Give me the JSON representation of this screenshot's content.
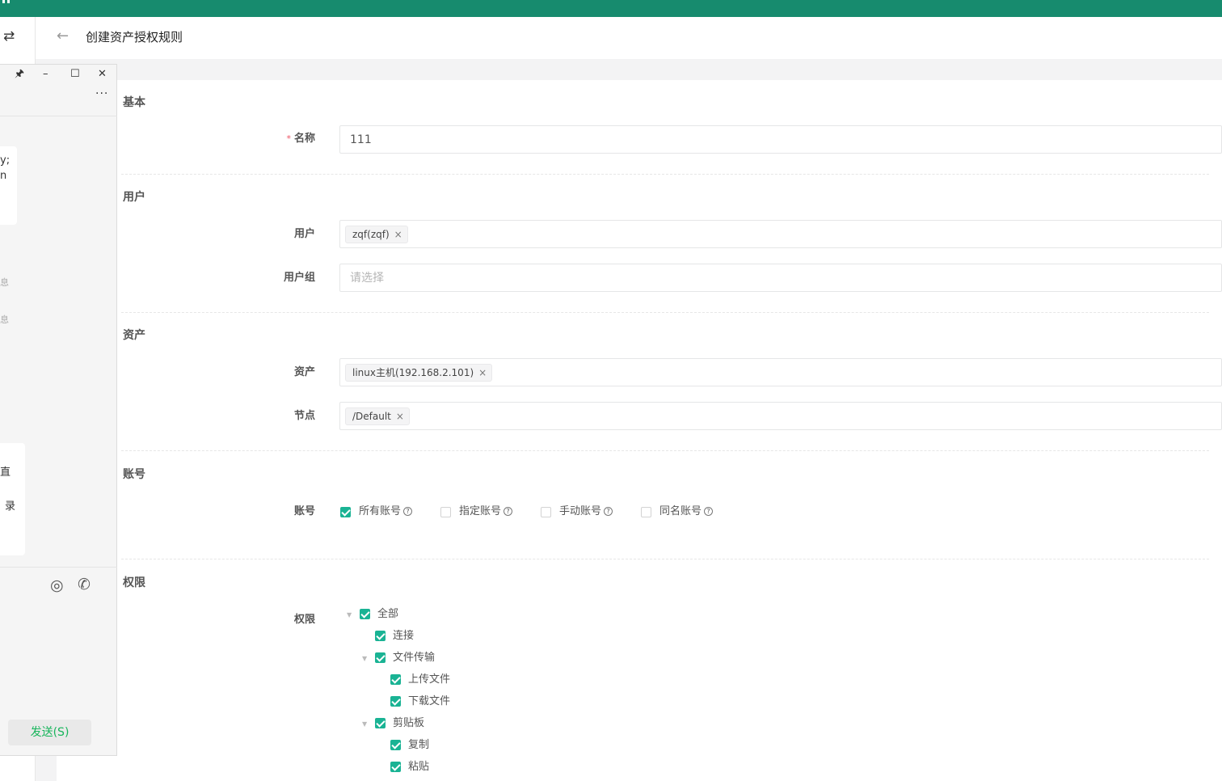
{
  "header": {
    "title": "创建资产授权规则"
  },
  "sections": {
    "basic": "基本",
    "user": "用户",
    "asset": "资产",
    "account": "账号",
    "permission": "权限"
  },
  "fields": {
    "name": {
      "label": "名称",
      "required_mark": "*",
      "value": "111"
    },
    "users": {
      "label": "用户",
      "tags": [
        "zqf(zqf)"
      ]
    },
    "user_groups": {
      "label": "用户组",
      "placeholder": "请选择"
    },
    "assets": {
      "label": "资产",
      "tags": [
        "linux主机(192.168.2.101)"
      ]
    },
    "nodes": {
      "label": "节点",
      "tags": [
        "/Default"
      ]
    },
    "accounts": {
      "label": "账号",
      "options": [
        {
          "label": "所有账号",
          "checked": true
        },
        {
          "label": "指定账号",
          "checked": false
        },
        {
          "label": "手动账号",
          "checked": false
        },
        {
          "label": "同名账号",
          "checked": false
        }
      ]
    },
    "permissions": {
      "label": "权限",
      "tree": [
        {
          "label": "全部",
          "checked": true
        },
        {
          "label": "连接",
          "checked": true
        },
        {
          "label": "文件传输",
          "checked": true
        },
        {
          "label": "上传文件",
          "checked": true
        },
        {
          "label": "下载文件",
          "checked": true
        },
        {
          "label": "剪贴板",
          "checked": true
        },
        {
          "label": "复制",
          "checked": true
        },
        {
          "label": "粘贴",
          "checked": true
        }
      ]
    }
  },
  "tag_close": "×",
  "help_glyph": "?",
  "chat_window": {
    "controls": {
      "pin": "🖈",
      "minimize": "–",
      "maximize": "☐",
      "close": "✕"
    },
    "more": "···",
    "snippets": [
      "y;",
      "n",
      "息",
      "息",
      "直",
      "录"
    ],
    "send_label": "发送(S)"
  },
  "colors": {
    "topbar": "#178b6e",
    "checkbox_on": "#1ab394",
    "required": "#ed5565",
    "send_text": "#17b55b"
  }
}
